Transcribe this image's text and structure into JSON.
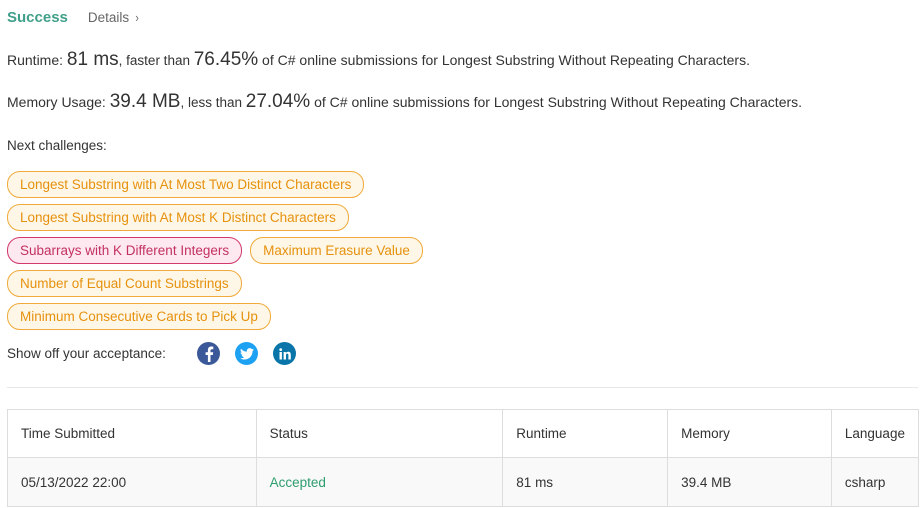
{
  "header": {
    "status": "Success",
    "details": "Details",
    "chevron": "›"
  },
  "runtime": {
    "label": "Runtime: ",
    "value": "81 ms",
    "mid": ", faster than ",
    "percent": "76.45%",
    "suffix": " of C# online submissions for Longest Substring Without Repeating Characters."
  },
  "memory": {
    "label": "Memory Usage: ",
    "value": "39.4 MB",
    "mid": ", less than ",
    "percent": "27.04%",
    "suffix": " of C# online submissions for Longest Substring Without Repeating Characters."
  },
  "next": {
    "label": "Next challenges:",
    "challenges": [
      {
        "title": "Longest Substring with At Most Two Distinct Characters",
        "difficulty": "medium"
      },
      {
        "title": "Longest Substring with At Most K Distinct Characters",
        "difficulty": "medium"
      },
      {
        "title": "Subarrays with K Different Integers",
        "difficulty": "hard"
      },
      {
        "title": "Maximum Erasure Value",
        "difficulty": "medium"
      },
      {
        "title": "Number of Equal Count Substrings",
        "difficulty": "medium"
      },
      {
        "title": "Minimum Consecutive Cards to Pick Up",
        "difficulty": "medium"
      }
    ]
  },
  "share": {
    "label": "Show off your acceptance:",
    "icons": [
      "facebook-icon",
      "twitter-icon",
      "linkedin-icon"
    ],
    "colors": {
      "facebook": "#3b5998",
      "twitter": "#1da1f2",
      "linkedin": "#0a75a8"
    }
  },
  "table": {
    "headers": [
      "Time Submitted",
      "Status",
      "Runtime",
      "Memory",
      "Language"
    ],
    "rows": [
      {
        "time": "05/13/2022 22:00",
        "status": "Accepted",
        "runtime": "81 ms",
        "memory": "39.4 MB",
        "language": "csharp"
      }
    ]
  },
  "colors": {
    "success": "#41a08a",
    "accepted": "#2e9d6e",
    "medium_chip": "#f0a93a",
    "hard_chip": "#d2386c"
  }
}
